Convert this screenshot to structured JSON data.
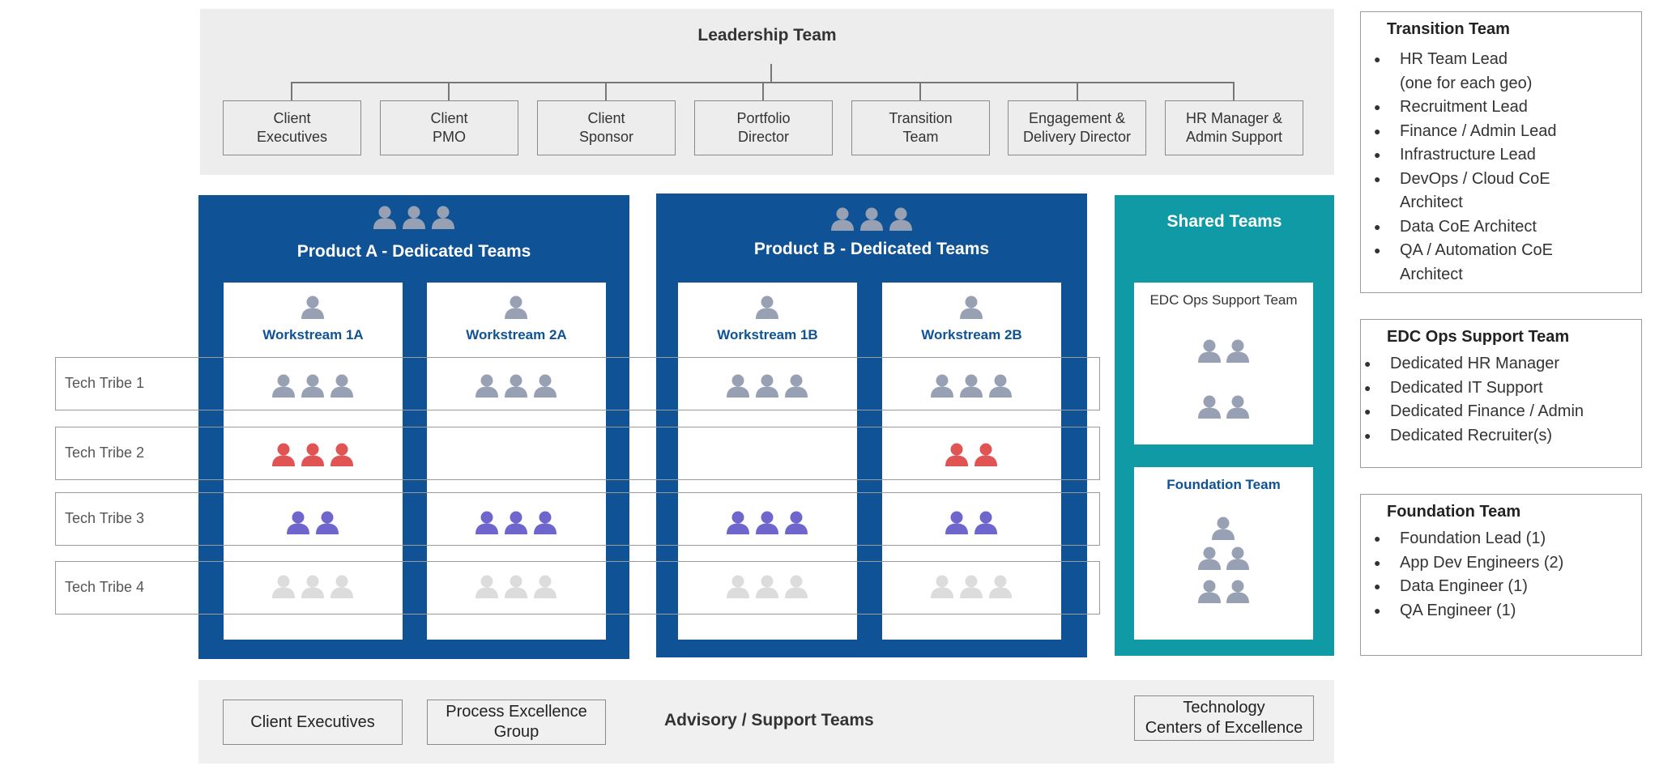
{
  "leadership": {
    "title": "Leadership Team",
    "boxes": [
      "Client\nExecutives",
      "Client\nPMO",
      "Client\nSponsor",
      "Portfolio\nDirector",
      "Transition\nTeam",
      "Engagement &\nDelivery Director",
      "HR Manager &\nAdmin Support"
    ]
  },
  "products": [
    {
      "title": "Product A - Dedicated Teams",
      "workstreams": [
        "Workstream 1A",
        "Workstream 2A"
      ]
    },
    {
      "title": "Product B - Dedicated Teams",
      "workstreams": [
        "Workstream 1B",
        "Workstream 2B"
      ]
    }
  ],
  "shared": {
    "title": "Shared Teams",
    "edc_card_title": "EDC Ops Support Team",
    "foundation_card_title": "Foundation Team"
  },
  "tribes": [
    "Tech Tribe 1",
    "Tech Tribe 2",
    "Tech Tribe 3",
    "Tech Tribe 4"
  ],
  "tribe_colors": {
    "tribe1": "#98a1b3",
    "tribe2": "#e05454",
    "tribe3": "#6e66cc",
    "tribe4": "#dcdcdc"
  },
  "staffing_counts": {
    "workstream_1a": [
      3,
      3,
      2,
      3
    ],
    "workstream_2a": [
      3,
      0,
      3,
      3
    ],
    "workstream_1b": [
      3,
      0,
      3,
      3
    ],
    "workstream_2b": [
      3,
      2,
      2,
      3
    ]
  },
  "advisory": {
    "label": "Advisory / Support Teams",
    "boxes": [
      "Client Executives",
      "Process Excellence\nGroup",
      "Technology\nCenters of Excellence"
    ]
  },
  "side_panels": {
    "transition": {
      "title": "Transition Team",
      "items": [
        "HR Team Lead\n(one for each geo)",
        "Recruitment Lead",
        "Finance / Admin Lead",
        "Infrastructure Lead",
        "DevOps / Cloud CoE\nArchitect",
        "Data CoE Architect",
        "QA / Automation CoE\nArchitect"
      ]
    },
    "edc": {
      "title": "EDC Ops Support Team",
      "items": [
        "Dedicated HR Manager",
        "Dedicated IT Support",
        "Dedicated Finance / Admin",
        "Dedicated Recruiter(s)"
      ]
    },
    "foundation": {
      "title": "Foundation Team",
      "items": [
        "Foundation Lead (1)",
        "App Dev Engineers (2)",
        "Data Engineer (1)",
        "QA Engineer (1)"
      ]
    }
  },
  "icon": "person-icon"
}
